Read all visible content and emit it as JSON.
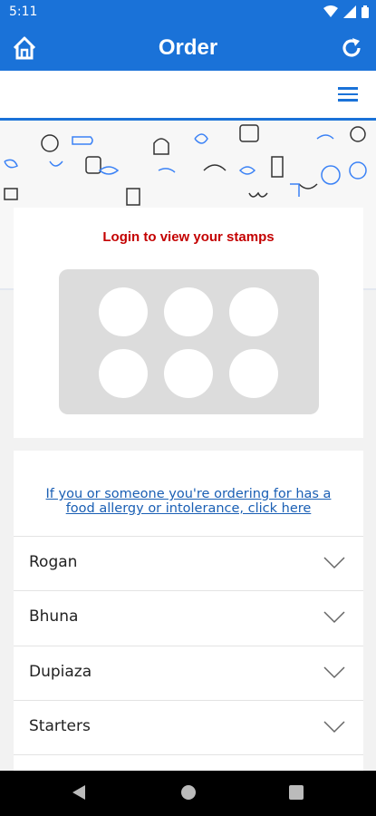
{
  "status_bar": {
    "time": "5:11"
  },
  "app_bar": {
    "title": "Order",
    "color": "#1a72d8"
  },
  "stamps": {
    "login_text": "Login to view your stamps",
    "count": 6
  },
  "menu": {
    "allergy_link": "If you or someone you're ordering for has a food allergy or intolerance, click here",
    "categories": [
      {
        "label": "Rogan"
      },
      {
        "label": "Bhuna"
      },
      {
        "label": "Dupiaza"
      },
      {
        "label": "Starters"
      }
    ]
  },
  "icons": {
    "home": "home-icon",
    "refresh": "refresh-icon",
    "menu": "hamburger-icon",
    "back": "back-triangle-icon",
    "home_nav": "home-circle-icon",
    "recents": "recents-square-icon"
  }
}
